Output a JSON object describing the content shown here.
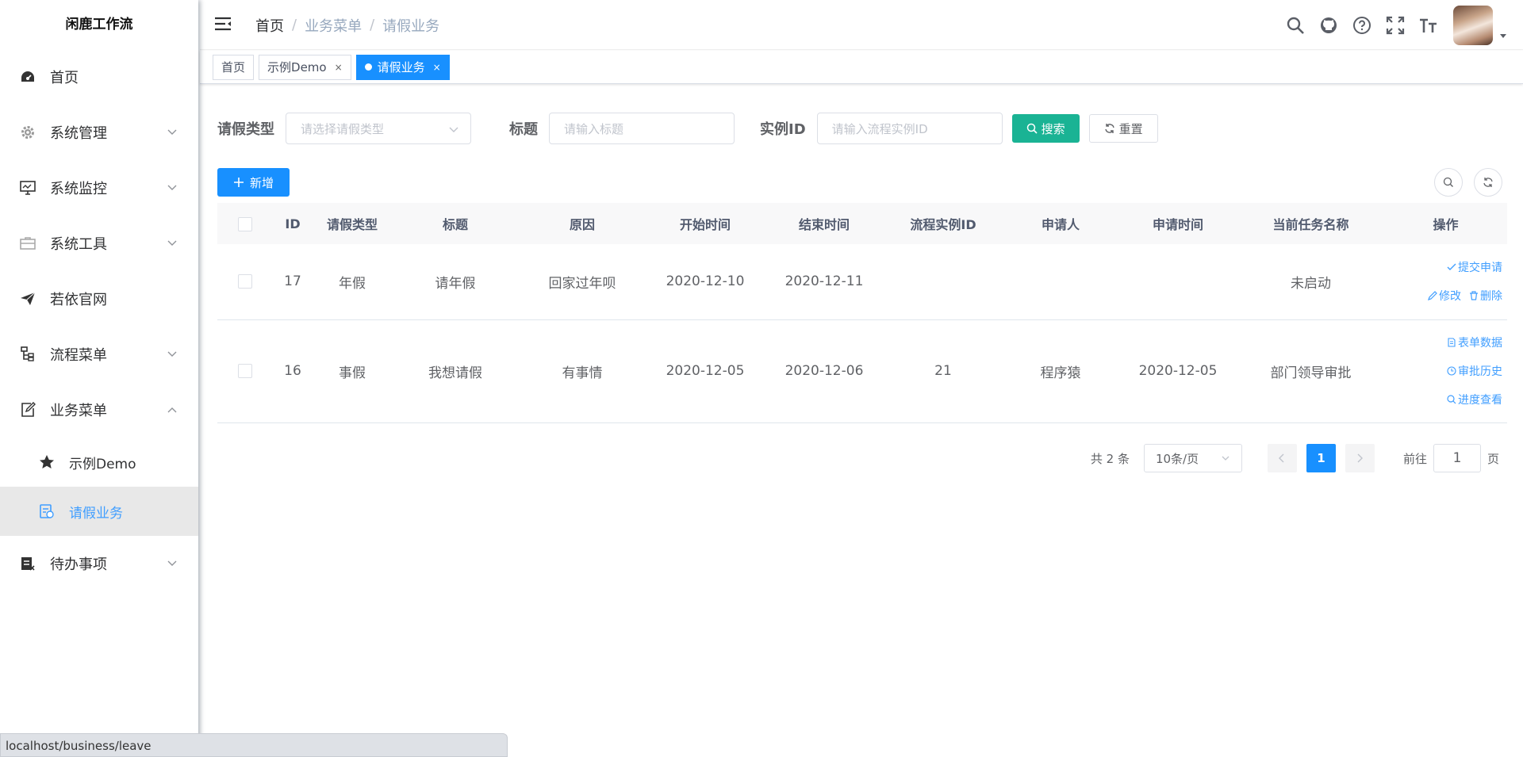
{
  "sidebar": {
    "logo": "闲鹿工作流",
    "items": [
      {
        "label": "首页",
        "icon": "dashboard-icon"
      },
      {
        "label": "系统管理",
        "icon": "gear-icon"
      },
      {
        "label": "系统监控",
        "icon": "monitor-icon"
      },
      {
        "label": "系统工具",
        "icon": "toolbox-icon"
      },
      {
        "label": "若依官网",
        "icon": "paper-plane-icon"
      },
      {
        "label": "流程菜单",
        "icon": "flow-icon"
      },
      {
        "label": "业务菜单",
        "icon": "edit-icon"
      },
      {
        "label": "待办事项",
        "icon": "todo-icon"
      }
    ],
    "sub_items": [
      {
        "label": "示例Demo",
        "icon": "star-icon"
      },
      {
        "label": "请假业务",
        "icon": "form-icon"
      }
    ]
  },
  "navbar": {
    "breadcrumb": [
      "首页",
      "业务菜单",
      "请假业务"
    ],
    "separator": "/"
  },
  "tags": [
    {
      "label": "首页"
    },
    {
      "label": "示例Demo",
      "close": "×"
    },
    {
      "label": "请假业务",
      "close": "×"
    }
  ],
  "search": {
    "leave_type_label": "请假类型",
    "leave_type_placeholder": "请选择请假类型",
    "title_label": "标题",
    "title_placeholder": "请输入标题",
    "instance_label": "实例ID",
    "instance_placeholder": "请输入流程实例ID",
    "search_btn": "搜索",
    "reset_btn": "重置"
  },
  "toolbar": {
    "add_btn": "新增"
  },
  "table": {
    "headers": [
      "ID",
      "请假类型",
      "标题",
      "原因",
      "开始时间",
      "结束时间",
      "流程实例ID",
      "申请人",
      "申请时间",
      "当前任务名称",
      "操作"
    ],
    "rows": [
      {
        "id": "17",
        "type": "年假",
        "title": "请年假",
        "reason": "回家过年呗",
        "start": "2020-12-10",
        "end": "2020-12-11",
        "instance": "",
        "applicant": "",
        "apply_time": "",
        "task": "未启动",
        "ops": {
          "submit": "提交申请",
          "edit": "修改",
          "delete": "删除"
        }
      },
      {
        "id": "16",
        "type": "事假",
        "title": "我想请假",
        "reason": "有事情",
        "start": "2020-12-05",
        "end": "2020-12-06",
        "instance": "21",
        "applicant": "程序猿",
        "apply_time": "2020-12-05",
        "task": "部门领导审批",
        "ops": {
          "form": "表单数据",
          "history": "审批历史",
          "progress": "进度查看"
        }
      }
    ]
  },
  "pagination": {
    "total": "共 2 条",
    "page_size": "10条/页",
    "current": "1",
    "goto_label": "前往",
    "goto_value": "1",
    "page_suffix": "页"
  },
  "statusbar": {
    "url": "localhost/business/leave"
  },
  "colors": {
    "primary": "#1890ff",
    "search": "#1ab394",
    "link": "#409eff"
  }
}
